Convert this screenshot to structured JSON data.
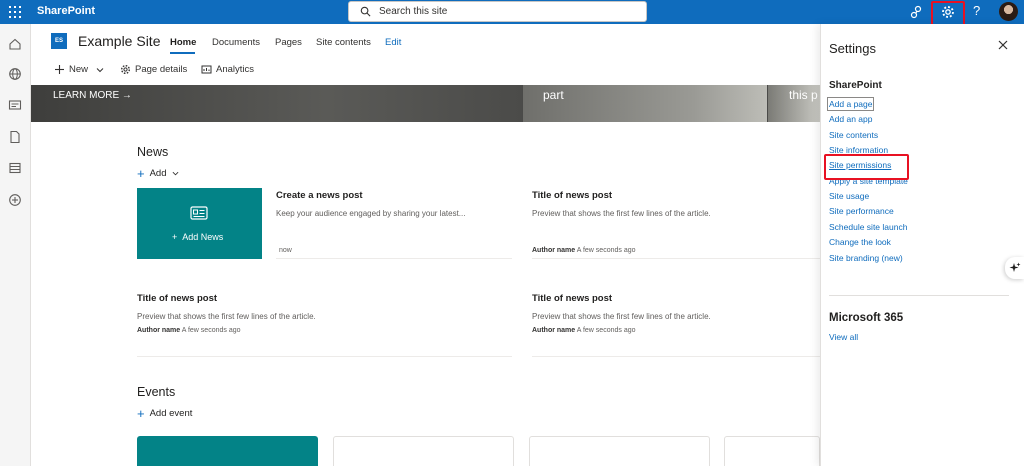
{
  "suitebar": {
    "brand": "SharePoint",
    "search_placeholder": "Search this site",
    "help": "?"
  },
  "site": {
    "logo_initials": "ES",
    "title": "Example Site",
    "nav": [
      "Home",
      "Documents",
      "Pages",
      "Site contents",
      "Edit"
    ]
  },
  "commands": {
    "new": "New",
    "page_details": "Page details",
    "analytics": "Analytics"
  },
  "hero": {
    "learn_more": "LEARN MORE",
    "tile2": "part",
    "tile3": "this p"
  },
  "news": {
    "heading": "News",
    "add": "Add",
    "tile_label": "Add News",
    "create": {
      "title": "Create a news post",
      "desc": "Keep your audience engaged by sharing your latest...",
      "meta": "now"
    },
    "posts": [
      {
        "title": "Title of news post",
        "desc": "Preview that shows the first few lines of the article.",
        "author": "Author name",
        "time": "A few seconds ago"
      },
      {
        "title": "Title of news post",
        "desc": "Preview that shows the first few lines of the article.",
        "author": "Author name",
        "time": "A few seconds ago"
      },
      {
        "title": "Title of news post",
        "desc": "Preview that shows the first few lines of the article.",
        "author": "Author name",
        "time": "A few seconds ago"
      }
    ]
  },
  "events": {
    "heading": "Events",
    "add": "Add event"
  },
  "settings": {
    "title": "Settings",
    "section_sharepoint": "SharePoint",
    "links": [
      "Add a page",
      "Add an app",
      "Site contents",
      "Site information",
      "Site permissions",
      "Apply a site template",
      "Site usage",
      "Site performance",
      "Schedule site launch",
      "Change the look",
      "Site branding (new)"
    ],
    "section_m365": "Microsoft 365",
    "view_all": "View all"
  },
  "colors": {
    "suitebar": "#0f6cbd",
    "teal": "#038387",
    "link": "#0f6cbd",
    "highlight": "#e81123"
  }
}
